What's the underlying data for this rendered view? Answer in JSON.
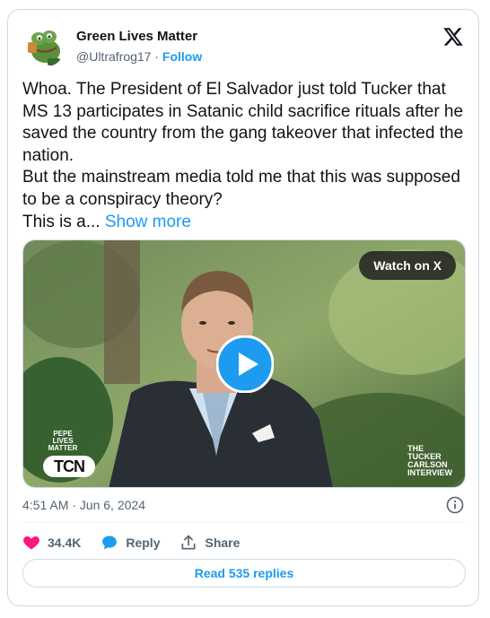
{
  "author": {
    "name": "Green Lives Matter",
    "handle": "@Ultrafrog17",
    "separator": "·",
    "follow_label": "Follow"
  },
  "tweet": {
    "lines": [
      "Whoa. The President of El Salvador just told Tucker that MS 13 participates in Satanic child sacrifice rituals after he saved the country from the gang takeover that infected the nation.",
      "But the mainstream media told me that this was supposed to be a conspiracy theory?"
    ],
    "truncated": "This is a...",
    "show_more": "Show more"
  },
  "video": {
    "watch_label": "Watch on X",
    "watermark_left": [
      "PEPE",
      "LIVES",
      "MATTER"
    ],
    "logo_left": "TCN",
    "watermark_right": [
      "THE",
      "TUCKER",
      "CARLSON",
      "INTERVIEW"
    ]
  },
  "meta": {
    "timestamp": "4:51 AM · Jun 6, 2024"
  },
  "actions": {
    "likes": "34.4K",
    "reply": "Reply",
    "share": "Share"
  },
  "replies_button": "Read 535 replies",
  "colors": {
    "accent": "#1d9bf0",
    "like": "#f91880",
    "muted": "#536471"
  }
}
